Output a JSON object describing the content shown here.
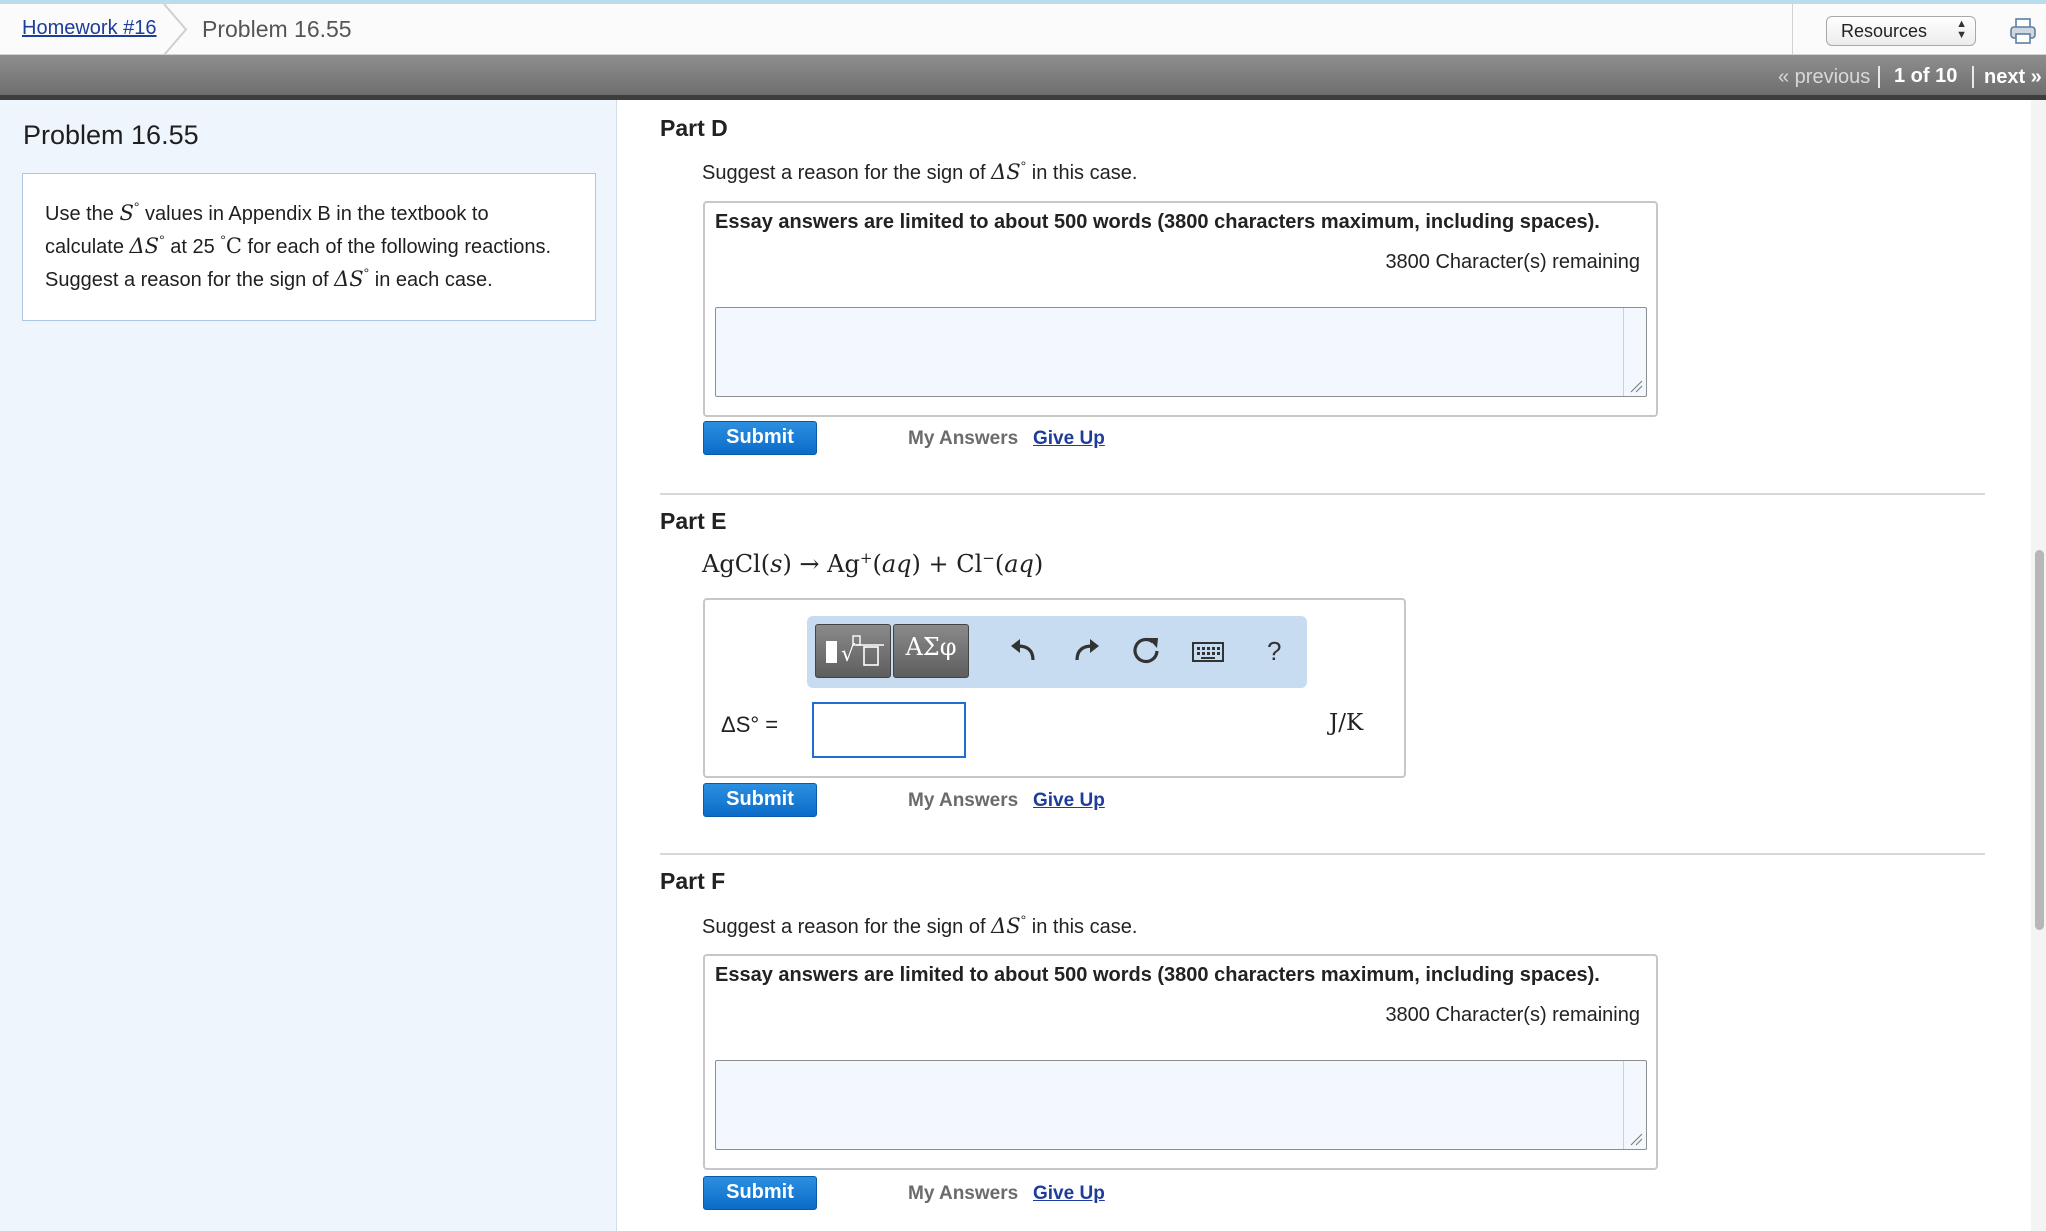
{
  "breadcrumb": {
    "homework_link": "Homework #16",
    "current": "Problem 16.55"
  },
  "header": {
    "resources_label": "Resources"
  },
  "nav": {
    "previous": "« previous",
    "page_indicator": "1 of 10",
    "next": "next »"
  },
  "problem": {
    "title": "Problem 16.55",
    "statement": {
      "t1": "Use the ",
      "s_symbol": "S",
      "t2": " values in Appendix B in the textbook to calculate ",
      "delta_s": "ΔS",
      "t3": " at 25 ",
      "temp_unit": "C",
      "t4": " for each of the following reactions. Suggest a reason for the sign of ",
      "t5": " in each case."
    }
  },
  "part_d": {
    "title": "Part D",
    "prompt_before": "Suggest a reason for the sign of ",
    "prompt_symbol": "ΔS",
    "prompt_after": " in this case.",
    "essay_note": "Essay answers are limited to about 500 words (3800 characters maximum, including spaces).",
    "remaining": "3800 Character(s) remaining",
    "submit": "Submit",
    "my_answers": "My Answers",
    "give_up": "Give Up"
  },
  "part_e": {
    "title": "Part E",
    "eq_agcl": "AgCl(",
    "eq_s": "s",
    "eq_mid": ") → Ag",
    "eq_plus_sup": "+",
    "eq_aq1_open": "(",
    "eq_aq": "aq",
    "eq_aq1_close": ") + Cl",
    "eq_minus_sup": "−",
    "eq_aq2_open": "(",
    "eq_aq2_close": ")",
    "greek_button": "ΑΣφ",
    "help": "?",
    "answer_label": "ΔS° =",
    "unit": "J/K",
    "submit": "Submit",
    "my_answers": "My Answers",
    "give_up": "Give Up"
  },
  "part_f": {
    "title": "Part F",
    "prompt_before": "Suggest a reason for the sign of ",
    "prompt_symbol": "ΔS",
    "prompt_after": " in this case.",
    "essay_note": "Essay answers are limited to about 500 words (3800 characters maximum, including spaces).",
    "remaining": "3800 Character(s) remaining",
    "submit": "Submit",
    "my_answers": "My Answers",
    "give_up": "Give Up"
  },
  "colors": {
    "accent_blue": "#0a6cc8",
    "link": "#1e3d9b",
    "panel_bg": "#eef5fc"
  },
  "icons": [
    "printer-icon",
    "undo-icon",
    "redo-icon",
    "reset-icon",
    "keyboard-icon",
    "template-icon"
  ]
}
